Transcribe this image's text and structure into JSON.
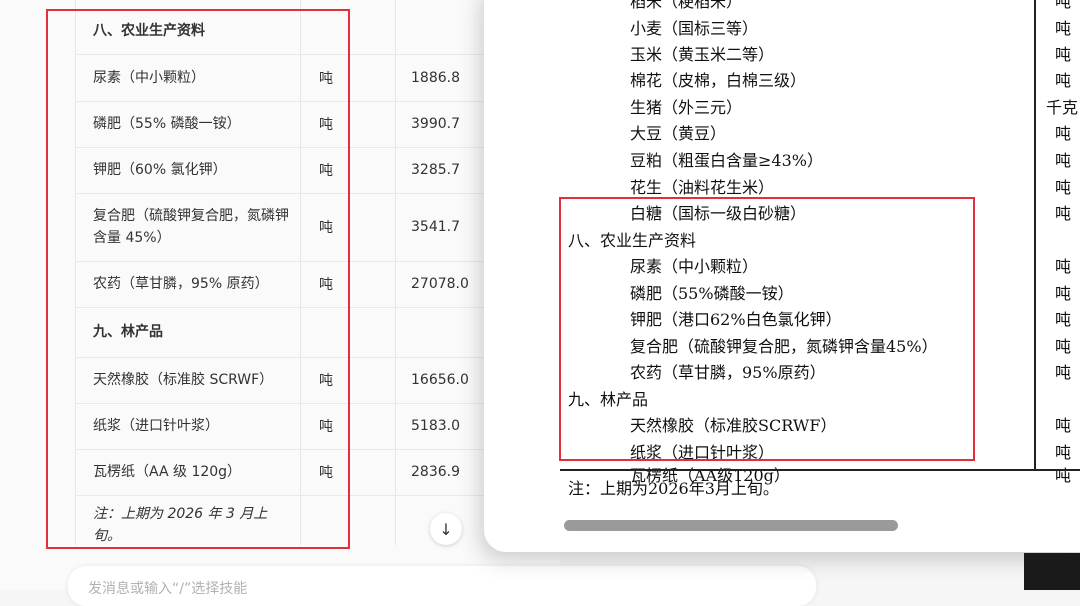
{
  "chat_table": {
    "rows": [
      {
        "type": "section",
        "name": "八、农业生产资料"
      },
      {
        "type": "item",
        "name": "尿素（中小颗粒）",
        "unit": "吨",
        "value": "1886.8"
      },
      {
        "type": "item",
        "name": "磷肥（55% 磷酸一铵）",
        "unit": "吨",
        "value": "3990.7"
      },
      {
        "type": "item",
        "name": "钾肥（60% 氯化钾）",
        "unit": "吨",
        "value": "3285.7"
      },
      {
        "type": "item",
        "name": "复合肥（硫酸钾复合肥，氮磷钾含量 45%）",
        "unit": "吨",
        "value": "3541.7"
      },
      {
        "type": "item",
        "name": "农药（草甘膦，95% 原药）",
        "unit": "吨",
        "value": "27078.0"
      },
      {
        "type": "section",
        "name": "九、林产品"
      },
      {
        "type": "item",
        "name": "天然橡胶（标准胶 SCRWF）",
        "unit": "吨",
        "value": "16656.0"
      },
      {
        "type": "item",
        "name": "纸浆（进口针叶浆）",
        "unit": "吨",
        "value": "5183.0"
      },
      {
        "type": "item",
        "name": "瓦楞纸（AA 级 120g）",
        "unit": "吨",
        "value": "2836.9"
      },
      {
        "type": "note",
        "name": "注：上期为 2026 年 3 月上旬。"
      }
    ],
    "input_placeholder": "发消息或输入“/”选择技能",
    "scroll_down_icon": "arrow-down-icon"
  },
  "document": {
    "lines": [
      {
        "text": "稻米（粳稻米）",
        "unit": "吨"
      },
      {
        "text": "小麦（国标三等）",
        "unit": "吨"
      },
      {
        "text": "玉米（黄玉米二等）",
        "unit": "吨"
      },
      {
        "text": "棉花（皮棉，白棉三级）",
        "unit": "吨"
      },
      {
        "text": "生猪（外三元）",
        "unit": "千克"
      },
      {
        "text": "大豆（黄豆）",
        "unit": "吨"
      },
      {
        "text": "豆粕（粗蛋白含量≥43%）",
        "unit": "吨"
      },
      {
        "text": "花生（油料花生米）",
        "unit": "吨"
      },
      {
        "text": "白糖（国标一级白砂糖）",
        "unit": "吨"
      }
    ],
    "section8": "八、农业生产资料",
    "section8_lines": [
      {
        "text": "尿素（中小颗粒）",
        "unit": "吨"
      },
      {
        "text": "磷肥（55%磷酸一铵）",
        "unit": "吨"
      },
      {
        "text": "钾肥（港口62%白色氯化钾）",
        "unit": "吨"
      },
      {
        "text": "复合肥（硫酸钾复合肥，氮磷钾含量45%）",
        "unit": "吨"
      },
      {
        "text": "农药（草甘膦，95%原药）",
        "unit": "吨"
      }
    ],
    "section9": "九、林产品",
    "section9_lines": [
      {
        "text": "天然橡胶（标准胶SCRWF）",
        "unit": "吨"
      },
      {
        "text": "纸浆（进口针叶浆）",
        "unit": "吨"
      },
      {
        "text": "瓦楞纸（AA级120g）",
        "unit": "吨"
      }
    ],
    "note": "注：上期为2026年3月上旬。"
  },
  "colors": {
    "highlight_box": "#e0313a"
  }
}
